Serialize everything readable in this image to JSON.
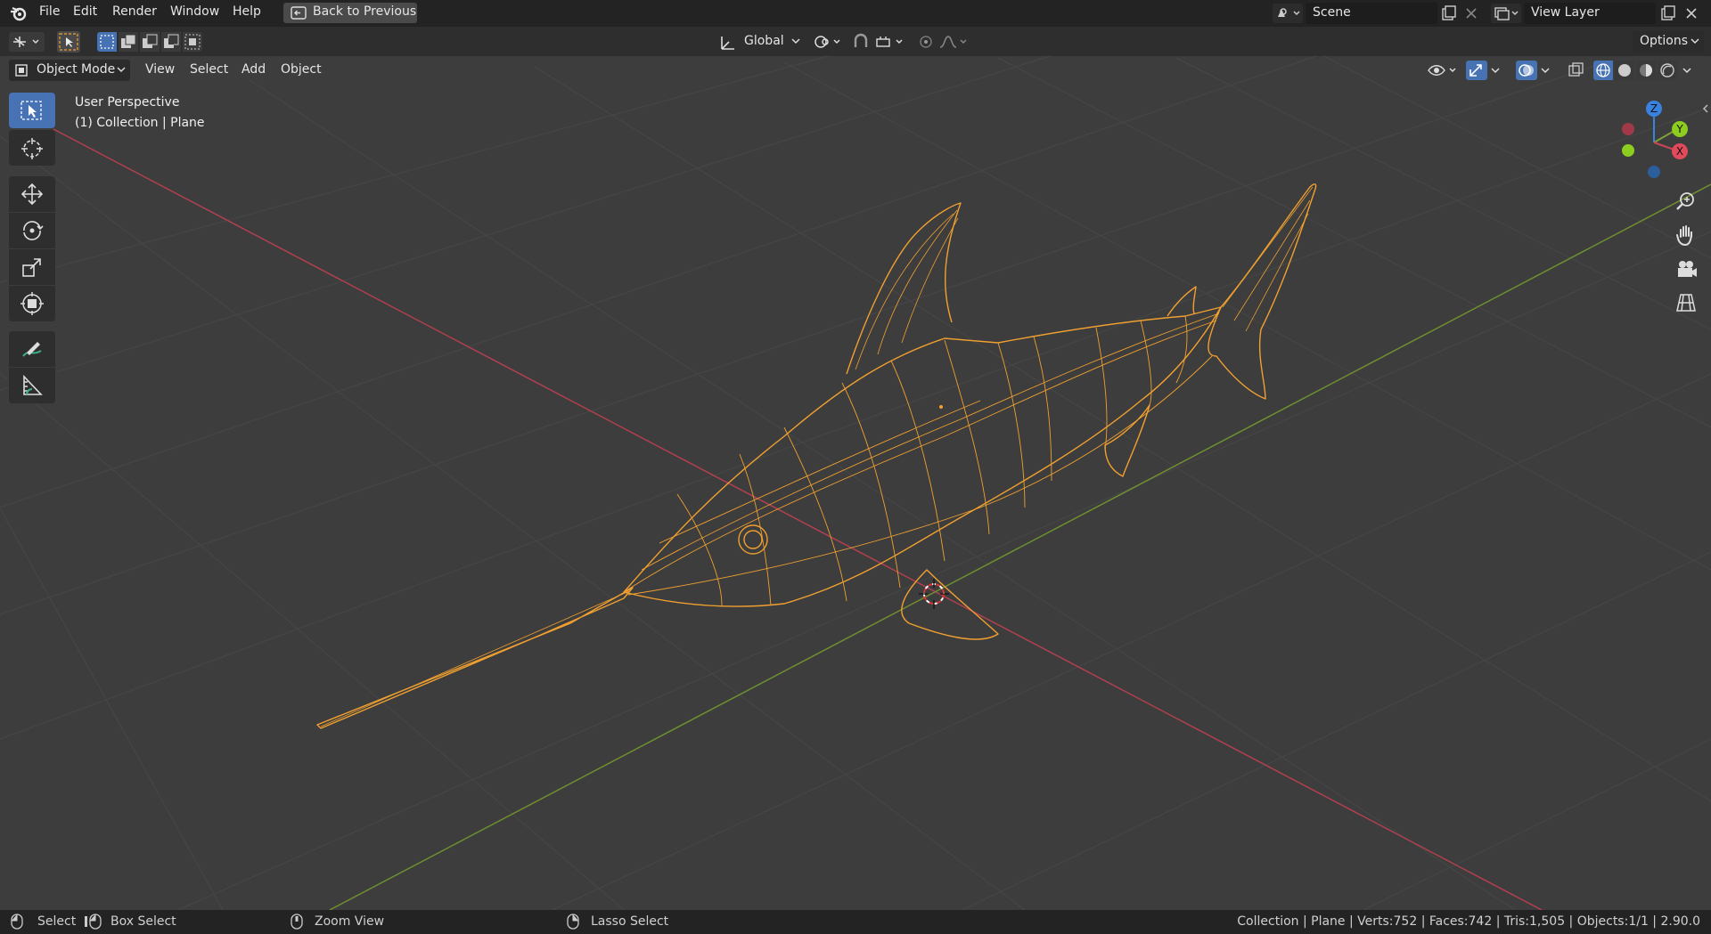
{
  "menubar": {
    "items": [
      "File",
      "Edit",
      "Render",
      "Window",
      "Help"
    ],
    "back_button": "Back to Previous",
    "scene": "Scene",
    "view_layer": "View Layer"
  },
  "toolheader": {
    "orientation": "Global",
    "options": "Options"
  },
  "viewheader": {
    "mode": "Object Mode",
    "menus": [
      "View",
      "Select",
      "Add",
      "Object"
    ]
  },
  "viewport": {
    "perspective": "User Perspective",
    "collection": "(1) Collection | Plane"
  },
  "gizmo": {
    "z": "Z",
    "y": "Y",
    "x": "X"
  },
  "statusbar": {
    "select": "Select",
    "box_select": "Box Select",
    "zoom_view": "Zoom View",
    "lasso_select": "Lasso Select",
    "stats": "Collection | Plane | Verts:752 | Faces:742 | Tris:1,505 | Objects:1/1 | 2.90.0"
  },
  "colors": {
    "accent": "#4772b3",
    "selection_orange": "#f0a030",
    "x_axis": "#c84656",
    "y_axis": "#7ea03a",
    "z_axis": "#3a82e0"
  }
}
